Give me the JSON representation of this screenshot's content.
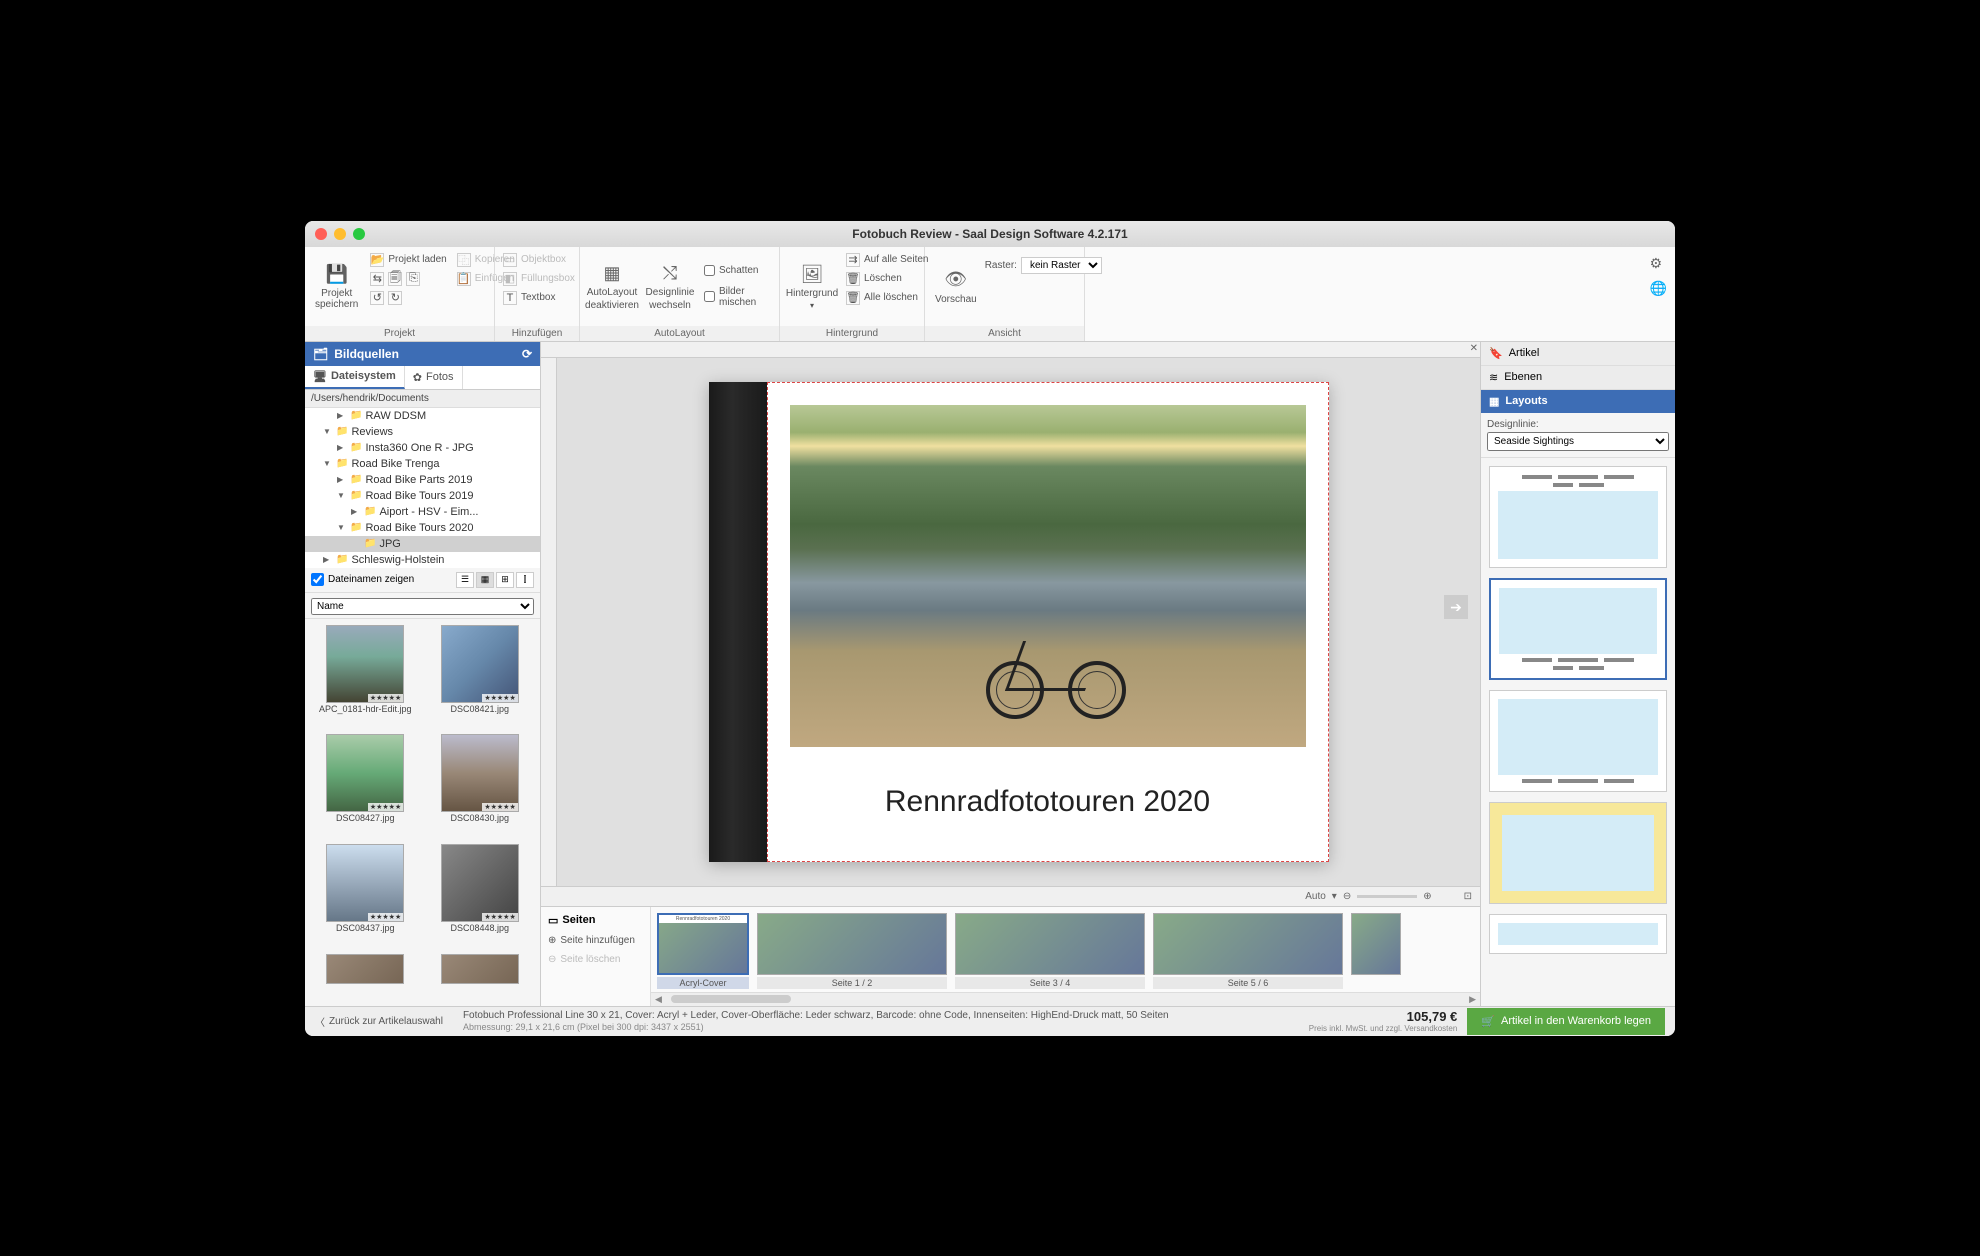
{
  "titlebar": {
    "title": "Fotobuch Review - Saal Design Software 4.2.171"
  },
  "ribbon": {
    "projekt": {
      "label": "Projekt",
      "save": "Projekt speichern",
      "load": "Projekt laden",
      "kopieren": "Kopieren",
      "einfugen": "Einfügen"
    },
    "hinzufugen": {
      "label": "Hinzufügen",
      "objektbox": "Objektbox",
      "fullungsbox": "Füllungsbox",
      "textbox": "Textbox"
    },
    "autolayout": {
      "label": "AutoLayout",
      "deaktivieren1": "AutoLayout",
      "deaktivieren2": "deaktivieren",
      "designlinie1": "Designlinie",
      "designlinie2": "wechseln",
      "schatten": "Schatten",
      "bildermischen": "Bilder mischen"
    },
    "hintergrund": {
      "label": "Hintergrund",
      "btn": "Hintergrund",
      "aufalle": "Auf alle Seiten",
      "loschen": "Löschen",
      "alleloschen": "Alle löschen"
    },
    "ansicht": {
      "label": "Ansicht",
      "vorschau": "Vorschau",
      "raster": "Raster:",
      "rasterval": "kein Raster"
    }
  },
  "left": {
    "header": "Bildquellen",
    "tab_fs": "Dateisystem",
    "tab_fotos": "Fotos",
    "path": "/Users/hendrik/Documents",
    "tree": [
      {
        "indent": 2,
        "arr": "▶",
        "name": "RAW DDSM"
      },
      {
        "indent": 1,
        "arr": "▼",
        "name": "Reviews"
      },
      {
        "indent": 2,
        "arr": "▶",
        "name": "Insta360 One R - JPG"
      },
      {
        "indent": 1,
        "arr": "▼",
        "name": "Road Bike Trenga"
      },
      {
        "indent": 2,
        "arr": "▶",
        "name": "Road  Bike Parts 2019"
      },
      {
        "indent": 2,
        "arr": "▼",
        "name": "Road Bike Tours 2019"
      },
      {
        "indent": 3,
        "arr": "▶",
        "name": "Aiport - HSV - Eim..."
      },
      {
        "indent": 2,
        "arr": "▼",
        "name": "Road Bike Tours 2020"
      },
      {
        "indent": 3,
        "arr": "",
        "name": "JPG",
        "sel": true
      },
      {
        "indent": 1,
        "arr": "▶",
        "name": "Schleswig-Holstein"
      }
    ],
    "show_filenames": "Dateinamen zeigen",
    "sort": "Name",
    "thumbs": [
      {
        "name": "APC_0181-hdr-Edit.jpg",
        "g": "linear-gradient(180deg,#9ab 0%,#7a9 40%,#443 100%)"
      },
      {
        "name": "DSC08421.jpg",
        "g": "linear-gradient(135deg,#8ac,#68a,#457)"
      },
      {
        "name": "DSC08427.jpg",
        "g": "linear-gradient(180deg,#aca,#6a7,#464)"
      },
      {
        "name": "DSC08430.jpg",
        "g": "linear-gradient(180deg,#bbc,#987,#654)"
      },
      {
        "name": "DSC08437.jpg",
        "g": "linear-gradient(180deg,#cde,#9ab,#678)"
      },
      {
        "name": "DSC08448.jpg",
        "g": "linear-gradient(135deg,#888,#666,#444)"
      }
    ]
  },
  "cover": {
    "title": "Rennradfototouren 2020"
  },
  "zoom": {
    "auto": "Auto"
  },
  "pages": {
    "header": "Seiten",
    "add": "Seite hinzufügen",
    "del": "Seite löschen",
    "items": [
      {
        "label": "Acryl-Cover",
        "cls": "",
        "sel": true,
        "sub": "Rennradfototouren 2020"
      },
      {
        "label": "Seite 1 / 2",
        "cls": "wide hamburg"
      },
      {
        "label": "Seite 3 / 4",
        "cls": "wide elb"
      },
      {
        "label": "Seite 5 / 6",
        "cls": "wide people"
      },
      {
        "label": "",
        "cls": "bikep partial"
      }
    ]
  },
  "right": {
    "artikel": "Artikel",
    "ebenen": "Ebenen",
    "layouts": "Layouts",
    "designlinie": "Designlinie:",
    "designval": "Seaside Sightings"
  },
  "status": {
    "back": "Zurück zur Artikelauswahl",
    "desc1": "Fotobuch Professional Line 30 x 21, Cover: Acryl + Leder, Cover-Oberfläche: Leder schwarz, Barcode: ohne Code, Innenseiten: HighEnd-Druck matt, 50 Seiten",
    "desc2": "Abmessung: 29,1 x 21,6 cm (Pixel bei 300 dpi: 3437 x 2551)",
    "price": "105,79 €",
    "price_sub": "Preis inkl. MwSt. und zzgl. Versandkosten",
    "cart": "Artikel in den Warenkorb legen"
  }
}
